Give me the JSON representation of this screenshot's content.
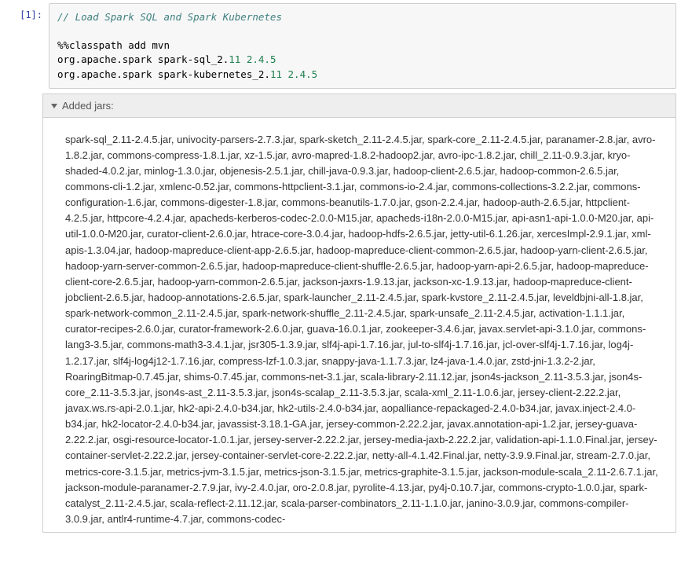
{
  "prompt_label": "[1]:",
  "code": {
    "comment": "// Load Spark SQL and Spark Kubernetes",
    "magic": "%%classpath add mvn",
    "line1_pkg": "org.apache.spark spark-sql_2.",
    "line1_n1": "11",
    "line1_mid": " ",
    "line1_n2": "2.4.5",
    "line2_pkg": "org.apache.spark spark-kubernetes_2.",
    "line2_n1": "11",
    "line2_mid": " ",
    "line2_n2": "2.4.5"
  },
  "summary_label": "Added jars:",
  "jars": "spark-sql_2.11-2.4.5.jar, univocity-parsers-2.7.3.jar, spark-sketch_2.11-2.4.5.jar, spark-core_2.11-2.4.5.jar, paranamer-2.8.jar, avro-1.8.2.jar, commons-compress-1.8.1.jar, xz-1.5.jar, avro-mapred-1.8.2-hadoop2.jar, avro-ipc-1.8.2.jar, chill_2.11-0.9.3.jar, kryo-shaded-4.0.2.jar, minlog-1.3.0.jar, objenesis-2.5.1.jar, chill-java-0.9.3.jar, hadoop-client-2.6.5.jar, hadoop-common-2.6.5.jar, commons-cli-1.2.jar, xmlenc-0.52.jar, commons-httpclient-3.1.jar, commons-io-2.4.jar, commons-collections-3.2.2.jar, commons-configuration-1.6.jar, commons-digester-1.8.jar, commons-beanutils-1.7.0.jar, gson-2.2.4.jar, hadoop-auth-2.6.5.jar, httpclient-4.2.5.jar, httpcore-4.2.4.jar, apacheds-kerberos-codec-2.0.0-M15.jar, apacheds-i18n-2.0.0-M15.jar, api-asn1-api-1.0.0-M20.jar, api-util-1.0.0-M20.jar, curator-client-2.6.0.jar, htrace-core-3.0.4.jar, hadoop-hdfs-2.6.5.jar, jetty-util-6.1.26.jar, xercesImpl-2.9.1.jar, xml-apis-1.3.04.jar, hadoop-mapreduce-client-app-2.6.5.jar, hadoop-mapreduce-client-common-2.6.5.jar, hadoop-yarn-client-2.6.5.jar, hadoop-yarn-server-common-2.6.5.jar, hadoop-mapreduce-client-shuffle-2.6.5.jar, hadoop-yarn-api-2.6.5.jar, hadoop-mapreduce-client-core-2.6.5.jar, hadoop-yarn-common-2.6.5.jar, jackson-jaxrs-1.9.13.jar, jackson-xc-1.9.13.jar, hadoop-mapreduce-client-jobclient-2.6.5.jar, hadoop-annotations-2.6.5.jar, spark-launcher_2.11-2.4.5.jar, spark-kvstore_2.11-2.4.5.jar, leveldbjni-all-1.8.jar, spark-network-common_2.11-2.4.5.jar, spark-network-shuffle_2.11-2.4.5.jar, spark-unsafe_2.11-2.4.5.jar, activation-1.1.1.jar, curator-recipes-2.6.0.jar, curator-framework-2.6.0.jar, guava-16.0.1.jar, zookeeper-3.4.6.jar, javax.servlet-api-3.1.0.jar, commons-lang3-3.5.jar, commons-math3-3.4.1.jar, jsr305-1.3.9.jar, slf4j-api-1.7.16.jar, jul-to-slf4j-1.7.16.jar, jcl-over-slf4j-1.7.16.jar, log4j-1.2.17.jar, slf4j-log4j12-1.7.16.jar, compress-lzf-1.0.3.jar, snappy-java-1.1.7.3.jar, lz4-java-1.4.0.jar, zstd-jni-1.3.2-2.jar, RoaringBitmap-0.7.45.jar, shims-0.7.45.jar, commons-net-3.1.jar, scala-library-2.11.12.jar, json4s-jackson_2.11-3.5.3.jar, json4s-core_2.11-3.5.3.jar, json4s-ast_2.11-3.5.3.jar, json4s-scalap_2.11-3.5.3.jar, scala-xml_2.11-1.0.6.jar, jersey-client-2.22.2.jar, javax.ws.rs-api-2.0.1.jar, hk2-api-2.4.0-b34.jar, hk2-utils-2.4.0-b34.jar, aopalliance-repackaged-2.4.0-b34.jar, javax.inject-2.4.0-b34.jar, hk2-locator-2.4.0-b34.jar, javassist-3.18.1-GA.jar, jersey-common-2.22.2.jar, javax.annotation-api-1.2.jar, jersey-guava-2.22.2.jar, osgi-resource-locator-1.0.1.jar, jersey-server-2.22.2.jar, jersey-media-jaxb-2.22.2.jar, validation-api-1.1.0.Final.jar, jersey-container-servlet-2.22.2.jar, jersey-container-servlet-core-2.22.2.jar, netty-all-4.1.42.Final.jar, netty-3.9.9.Final.jar, stream-2.7.0.jar, metrics-core-3.1.5.jar, metrics-jvm-3.1.5.jar, metrics-json-3.1.5.jar, metrics-graphite-3.1.5.jar, jackson-module-scala_2.11-2.6.7.1.jar, jackson-module-paranamer-2.7.9.jar, ivy-2.4.0.jar, oro-2.0.8.jar, pyrolite-4.13.jar, py4j-0.10.7.jar, commons-crypto-1.0.0.jar, spark-catalyst_2.11-2.4.5.jar, scala-reflect-2.11.12.jar, scala-parser-combinators_2.11-1.1.0.jar, janino-3.0.9.jar, commons-compiler-3.0.9.jar, antlr4-runtime-4.7.jar, commons-codec-"
}
